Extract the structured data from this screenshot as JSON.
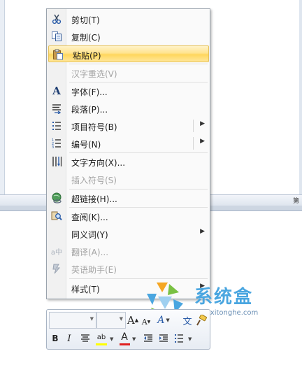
{
  "background": {
    "status_text": "第"
  },
  "menu": {
    "items": [
      {
        "label": "剪切(T)",
        "icon": "scissors-icon",
        "disabled": false
      },
      {
        "label": "复制(C)",
        "icon": "copy-icon",
        "disabled": false
      },
      {
        "label": "粘贴(P)",
        "icon": "paste-icon",
        "disabled": false,
        "highlighted": true
      },
      {
        "label": "汉字重选(V)",
        "icon": "",
        "disabled": true
      },
      {
        "label": "字体(F)...",
        "icon": "font-icon",
        "disabled": false
      },
      {
        "label": "段落(P)...",
        "icon": "paragraph-icon",
        "disabled": false
      },
      {
        "label": "项目符号(B)",
        "icon": "bullets-icon",
        "disabled": false,
        "submenu": true
      },
      {
        "label": "编号(N)",
        "icon": "numbering-icon",
        "disabled": false,
        "submenu": true
      },
      {
        "label": "文字方向(X)...",
        "icon": "text-direction-icon",
        "disabled": false
      },
      {
        "label": "插入符号(S)",
        "icon": "",
        "disabled": true
      },
      {
        "label": "超链接(H)...",
        "icon": "hyperlink-icon",
        "disabled": false
      },
      {
        "label": "查阅(K)...",
        "icon": "lookup-icon",
        "disabled": false
      },
      {
        "label": "同义词(Y)",
        "icon": "",
        "disabled": false,
        "submenu": true
      },
      {
        "label": "翻译(A)...",
        "icon": "translate-icon",
        "disabled": true
      },
      {
        "label": "英语助手(E)",
        "icon": "english-assistant-icon",
        "disabled": true
      },
      {
        "label": "样式(T)",
        "icon": "",
        "disabled": false,
        "submenu": true
      }
    ]
  },
  "mini_toolbar": {
    "grow_font": "A",
    "shrink_font": "A",
    "styles": "A",
    "phonetic": "文",
    "bold": "B",
    "italic": "I",
    "highlight_glyph": "ab",
    "font_color_glyph": "A",
    "highlight_color": "#ffff00",
    "font_color": "#e02020"
  },
  "watermark": {
    "name": "系统盒",
    "url": "www.xitonghe.com"
  }
}
